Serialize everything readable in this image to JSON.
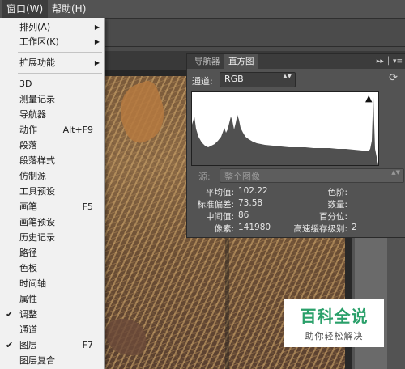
{
  "menubar": {
    "items": [
      {
        "label": "窗口(W)",
        "active": true
      },
      {
        "label": "帮助(H)",
        "active": false
      }
    ]
  },
  "window_menu": {
    "items": [
      {
        "label": "排列(A)",
        "submenu": true
      },
      {
        "label": "工作区(K)",
        "submenu": true
      },
      {
        "label": "扩展功能",
        "submenu": true
      },
      {
        "label": "3D"
      },
      {
        "label": "测量记录"
      },
      {
        "label": "导航器"
      },
      {
        "label": "动作",
        "shortcut": "Alt+F9"
      },
      {
        "label": "段落"
      },
      {
        "label": "段落样式"
      },
      {
        "label": "仿制源"
      },
      {
        "label": "工具预设"
      },
      {
        "label": "画笔",
        "shortcut": "F5"
      },
      {
        "label": "画笔预设"
      },
      {
        "label": "历史记录"
      },
      {
        "label": "路径"
      },
      {
        "label": "色板"
      },
      {
        "label": "时间轴"
      },
      {
        "label": "属性"
      },
      {
        "label": "调整",
        "checked": true
      },
      {
        "label": "通道"
      },
      {
        "label": "图层",
        "checked": true,
        "shortcut": "F7"
      },
      {
        "label": "图层复合"
      }
    ],
    "check_glyph": "✔",
    "arrow_glyph": "▶"
  },
  "histogram_panel": {
    "tabs": [
      {
        "label": "导航器",
        "active": false
      },
      {
        "label": "直方图",
        "active": true
      }
    ],
    "header_icons": "▸▸ │ ▾≡",
    "channel_label": "通道:",
    "channel_value": "RGB",
    "select_arrow": "▲▼",
    "refresh_icon": "⟳",
    "warning_icon": "▲",
    "source_label": "源:",
    "source_value": "整个图像",
    "stats_left": [
      {
        "label": "平均值:",
        "value": "102.22"
      },
      {
        "label": "标准偏差:",
        "value": "73.58"
      },
      {
        "label": "中间值:",
        "value": "86"
      },
      {
        "label": "像素:",
        "value": "141980"
      }
    ],
    "stats_right": [
      {
        "label": "色阶:",
        "value": ""
      },
      {
        "label": "数量:",
        "value": ""
      },
      {
        "label": "百分位:",
        "value": ""
      },
      {
        "label": "高速缓存级别:",
        "value": "2"
      }
    ]
  },
  "watermark": {
    "title": "百科全说",
    "subtitle": "助你轻松解决",
    "color": "#2aa06a"
  }
}
